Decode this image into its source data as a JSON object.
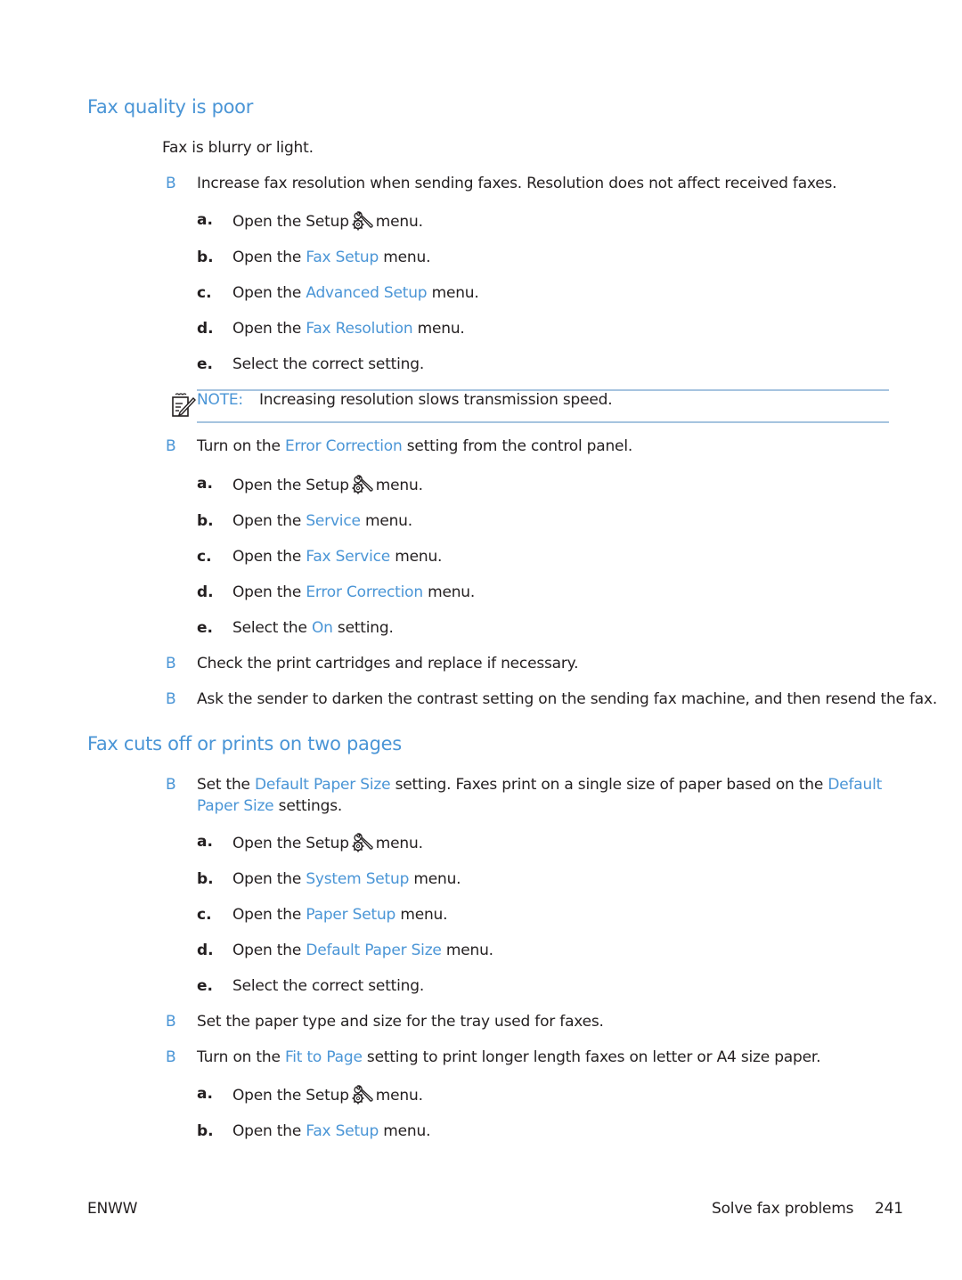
{
  "colors": {
    "accent": "#4a95d6",
    "text": "#231f20",
    "note_rule": "#a6c4df"
  },
  "sections": [
    {
      "heading": "Fax quality is poor",
      "intro": "Fax is blurry or light.",
      "bullet_glyph": "B",
      "items": [
        {
          "text": "Increase fax resolution when sending faxes. Resolution does not affect received faxes.",
          "steps": [
            {
              "label": "a.",
              "pre": "Open the Setup",
              "icon": "setup-wrench-gear-icon",
              "post": "menu."
            },
            {
              "label": "b.",
              "pre": "Open the ",
              "link": "Fax Setup",
              "post": " menu."
            },
            {
              "label": "c.",
              "pre": "Open the ",
              "link": "Advanced Setup",
              "post": " menu."
            },
            {
              "label": "d.",
              "pre": "Open the ",
              "link": "Fax Resolution",
              "post": " menu."
            },
            {
              "label": "e.",
              "pre": "Select the correct setting."
            }
          ],
          "note": {
            "label": "NOTE:",
            "text": "Increasing resolution slows transmission speed.",
            "icon": "note-pencil-icon"
          }
        },
        {
          "pre": "Turn on the ",
          "link": "Error Correction",
          "post": " setting from the control panel.",
          "steps": [
            {
              "label": "a.",
              "pre": "Open the Setup",
              "icon": "setup-wrench-gear-icon",
              "post": "menu."
            },
            {
              "label": "b.",
              "pre": "Open the ",
              "link": "Service",
              "post": " menu."
            },
            {
              "label": "c.",
              "pre": "Open the ",
              "link": "Fax Service",
              "post": " menu."
            },
            {
              "label": "d.",
              "pre": "Open the ",
              "link": "Error Correction",
              "post": " menu."
            },
            {
              "label": "e.",
              "pre": "Select the ",
              "link": "On",
              "post": " setting."
            }
          ]
        },
        {
          "text": "Check the print cartridges and replace if necessary."
        },
        {
          "text": "Ask the sender to darken the contrast setting on the sending fax machine, and then resend the fax."
        }
      ]
    },
    {
      "heading": "Fax cuts off or prints on two pages",
      "items": [
        {
          "pre": "Set the ",
          "link": "Default Paper Size",
          "mid": " setting. Faxes print on a single size of paper based on the ",
          "link2a": "Default",
          "link2b": "Paper Size",
          "post": " settings.",
          "steps": [
            {
              "label": "a.",
              "pre": "Open the Setup",
              "icon": "setup-wrench-gear-icon",
              "post": "menu."
            },
            {
              "label": "b.",
              "pre": "Open the ",
              "link": "System Setup",
              "post": " menu."
            },
            {
              "label": "c.",
              "pre": "Open the ",
              "link": "Paper Setup",
              "post": " menu."
            },
            {
              "label": "d.",
              "pre": "Open the ",
              "link": "Default Paper Size",
              "post": " menu."
            },
            {
              "label": "e.",
              "pre": "Select the correct setting."
            }
          ]
        },
        {
          "text": "Set the paper type and size for the tray used for faxes."
        },
        {
          "pre": "Turn on the ",
          "link": "Fit to Page",
          "post": " setting to print longer length faxes on letter or A4 size paper.",
          "steps": [
            {
              "label": "a.",
              "pre": "Open the Setup",
              "icon": "setup-wrench-gear-icon",
              "post": "menu."
            },
            {
              "label": "b.",
              "pre": "Open the ",
              "link": "Fax Setup",
              "post": " menu."
            }
          ]
        }
      ]
    }
  ],
  "footer": {
    "left": "ENWW",
    "section": "Solve fax problems",
    "page": "241"
  }
}
